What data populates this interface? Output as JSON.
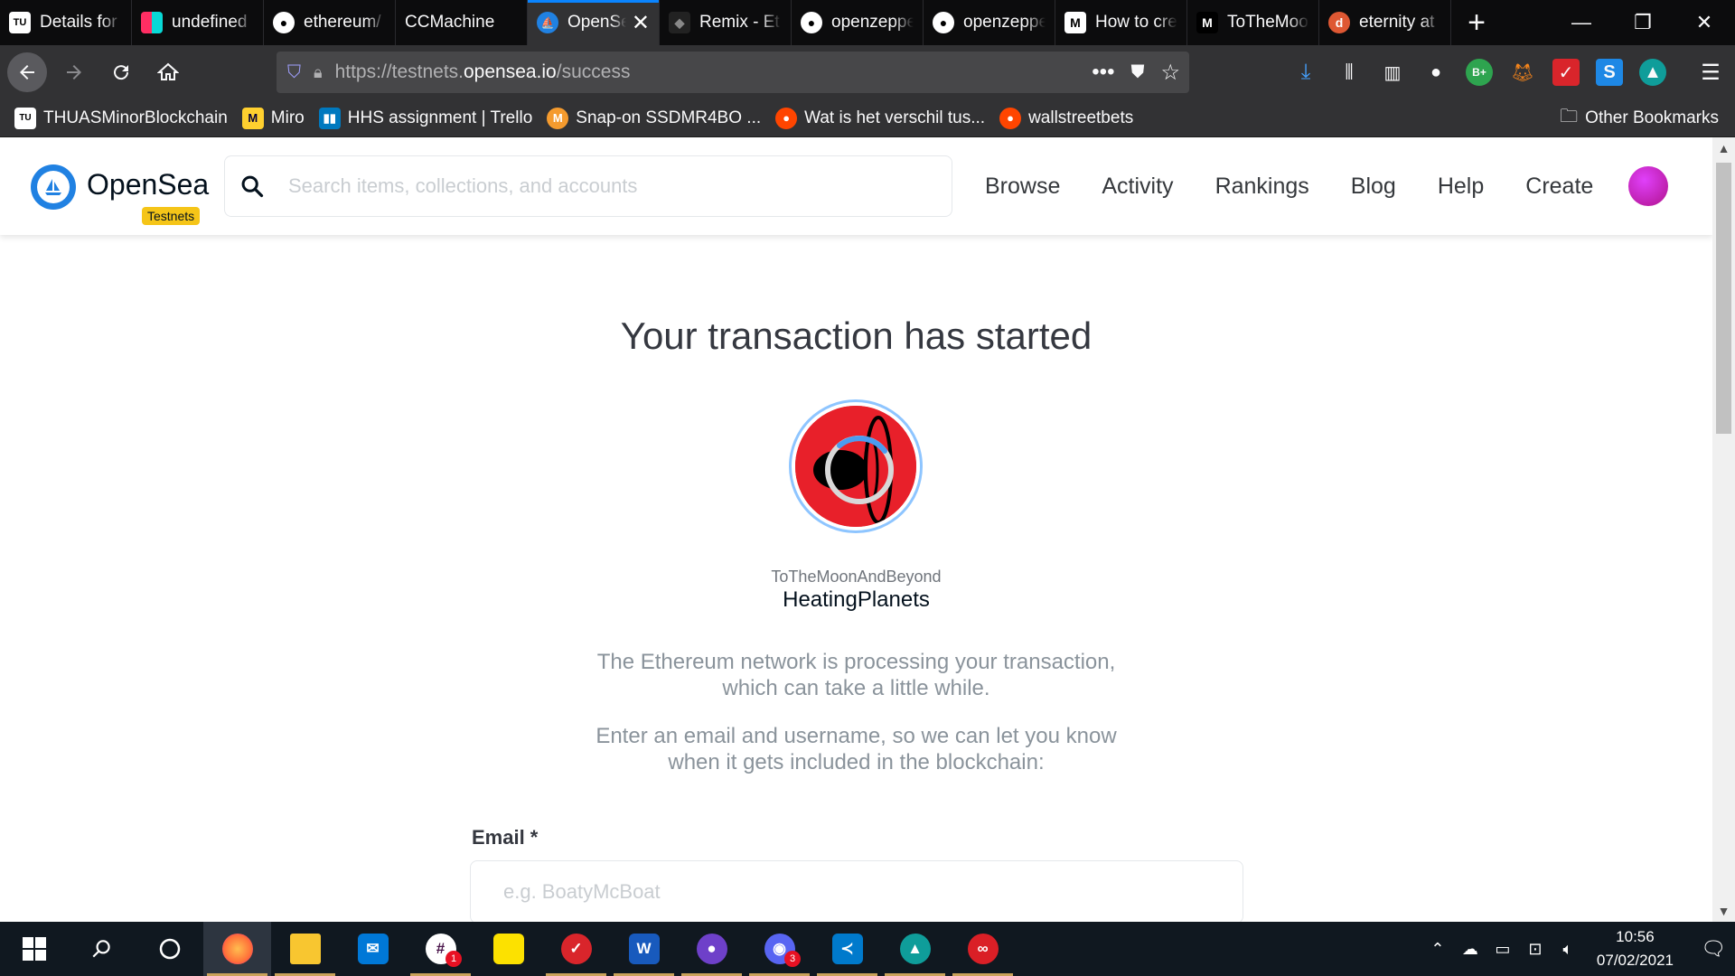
{
  "browser": {
    "tabs": [
      {
        "title": "Details for",
        "favicon": "tue-logo-icon",
        "color": "#ffffff",
        "active": false
      },
      {
        "title": "undefined",
        "favicon": "colored-squares-icon",
        "color": "#ff2e63",
        "active": false
      },
      {
        "title": "ethereum/",
        "favicon": "github-icon",
        "color": "#ffffff",
        "active": false
      },
      {
        "title": "CCMachine",
        "favicon": "",
        "color": "",
        "active": false
      },
      {
        "title": "OpenSea",
        "favicon": "opensea-icon",
        "color": "#2081e2",
        "active": true
      },
      {
        "title": "Remix - Et",
        "favicon": "remix-icon",
        "color": "#222222",
        "active": false
      },
      {
        "title": "openzeppe",
        "favicon": "github-icon",
        "color": "#ffffff",
        "active": false
      },
      {
        "title": "openzeppe",
        "favicon": "github-icon",
        "color": "#ffffff",
        "active": false
      },
      {
        "title": "How to cre",
        "favicon": "medium-icon",
        "color": "#ffffff",
        "active": false
      },
      {
        "title": "ToTheMoo",
        "favicon": "medium-icon",
        "color": "#ffffff",
        "active": false
      },
      {
        "title": "eternity at",
        "favicon": "duckduckgo-icon",
        "color": "#de5833",
        "active": false
      }
    ],
    "url_prefix": "https://testnets.",
    "url_host": "opensea.io",
    "url_path": "/success",
    "bookmarks": [
      {
        "label": "THUASMinorBlockchain",
        "icon": "tue-logo-icon",
        "color": "#ffffff"
      },
      {
        "label": "Miro",
        "icon": "miro-icon",
        "color": "#ffd02f"
      },
      {
        "label": "HHS assignment | Trello",
        "icon": "trello-icon",
        "color": "#0079bf"
      },
      {
        "label": "Snap-on SSDMR4BO ...",
        "icon": "snapon-icon",
        "color": "#f59b2e"
      },
      {
        "label": "Wat is het verschil tus...",
        "icon": "reddit-icon",
        "color": "#ff4500"
      },
      {
        "label": "wallstreetbets",
        "icon": "reddit-icon",
        "color": "#ff4500"
      }
    ],
    "other_bookmarks": "Other Bookmarks"
  },
  "opensea": {
    "brand": "OpenSea",
    "badge": "Testnets",
    "search_placeholder": "Search items, collections, and accounts",
    "nav": [
      "Browse",
      "Activity",
      "Rankings",
      "Blog",
      "Help",
      "Create"
    ]
  },
  "main": {
    "title": "Your transaction has started",
    "collection": "ToTheMoonAndBeyond",
    "item_name": "HeatingPlanets",
    "desc1_line1": "The Ethereum network is processing your transaction,",
    "desc1_line2": "which can take a little while.",
    "desc2_line1": "Enter an email and username, so we can let you know",
    "desc2_line2": "when it gets included in the blockchain:",
    "email_label": "Email *",
    "email_placeholder": "e.g. BoatyMcBoat"
  },
  "taskbar": {
    "apps": [
      {
        "name": "firefox",
        "color": "#ff7139",
        "open": true,
        "active": true,
        "badge": ""
      },
      {
        "name": "file-explorer",
        "color": "#f8c630",
        "open": true,
        "active": false,
        "badge": ""
      },
      {
        "name": "mail",
        "color": "#0078d7",
        "open": false,
        "active": false,
        "badge": ""
      },
      {
        "name": "slack",
        "color": "#4a154b",
        "open": true,
        "active": false,
        "badge": "1"
      },
      {
        "name": "sticky-notes",
        "color": "#fce100",
        "open": false,
        "active": false,
        "badge": ""
      },
      {
        "name": "app-red",
        "color": "#d9252b",
        "open": true,
        "active": false,
        "badge": ""
      },
      {
        "name": "word",
        "color": "#185abd",
        "open": true,
        "active": false,
        "badge": ""
      },
      {
        "name": "github-desktop",
        "color": "#6e40c9",
        "open": true,
        "active": false,
        "badge": ""
      },
      {
        "name": "discord",
        "color": "#5865f2",
        "open": true,
        "active": false,
        "badge": "3"
      },
      {
        "name": "vscode",
        "color": "#007acc",
        "open": true,
        "active": false,
        "badge": ""
      },
      {
        "name": "app-teal",
        "color": "#0f9d9a",
        "open": true,
        "active": false,
        "badge": ""
      },
      {
        "name": "creative-cloud",
        "color": "#da1f26",
        "open": true,
        "active": false,
        "badge": ""
      }
    ],
    "time": "10:56",
    "date": "07/02/2021"
  }
}
